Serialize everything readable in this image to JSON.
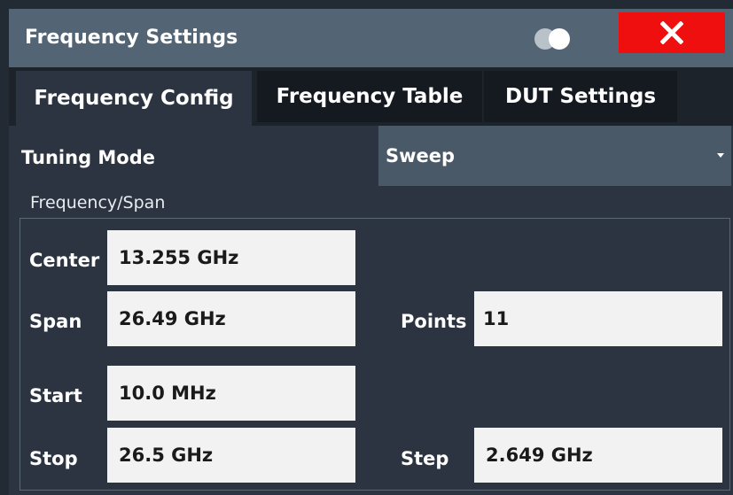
{
  "window": {
    "title": "Frequency Settings",
    "close_symbol": "✕",
    "close_icon": "close-icon",
    "toggle_icon": "toggle-icon",
    "close_color": "#ef0f0f"
  },
  "tabs": [
    {
      "label": "Frequency Config",
      "active": true
    },
    {
      "label": "Frequency Table",
      "active": false
    },
    {
      "label": "DUT Settings",
      "active": false
    }
  ],
  "tuning": {
    "label": "Tuning Mode",
    "value": "Sweep"
  },
  "freq_span": {
    "group_label": "Frequency/Span",
    "center": {
      "label": "Center",
      "value": "13.255 GHz"
    },
    "span": {
      "label": "Span",
      "value": "26.49 GHz"
    },
    "points": {
      "label": "Points",
      "value": "11"
    },
    "start": {
      "label": "Start",
      "value": "10.0 MHz"
    },
    "stop": {
      "label": "Stop",
      "value": "26.5 GHz"
    },
    "step": {
      "label": "Step",
      "value": "2.649 GHz"
    }
  }
}
